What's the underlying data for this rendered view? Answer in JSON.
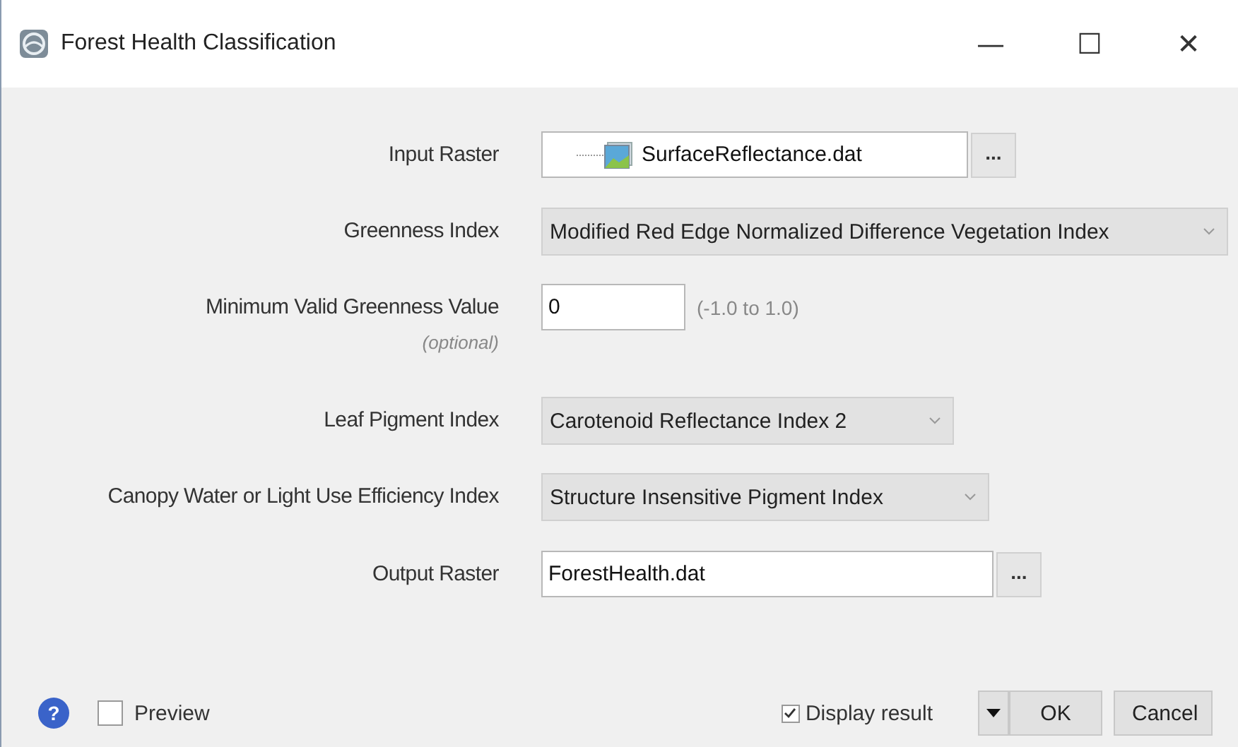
{
  "window": {
    "title": "Forest Health Classification",
    "controls": [
      "—",
      "☐",
      "✕"
    ]
  },
  "fields": [
    {
      "kind": "file",
      "label": "Input Raster",
      "value": "SurfaceReflectance.dat",
      "browse": "...",
      "has_icon": true
    },
    {
      "kind": "dropdown",
      "label": "Greenness Index",
      "value": "Modified Red Edge Normalized Difference Vegetation Index"
    },
    {
      "kind": "number",
      "label": "Minimum Valid Greenness Value",
      "note": "(optional)",
      "value": "0",
      "hint": "(-1.0 to 1.0)"
    },
    {
      "kind": "dropdown",
      "label": "Leaf Pigment Index",
      "value": "Carotenoid Reflectance Index 2"
    },
    {
      "kind": "dropdown",
      "label": "Canopy Water or Light Use Efficiency Index",
      "value": "Structure Insensitive Pigment Index"
    },
    {
      "kind": "file",
      "label": "Output Raster",
      "value": "ForestHealth.dat",
      "browse": "...",
      "has_icon": false
    }
  ],
  "footer": {
    "help": "?",
    "preview": {
      "label": "Preview",
      "checked": false
    },
    "display_result": {
      "label": "Display result",
      "checked": true
    },
    "ok": "OK",
    "cancel": "Cancel"
  }
}
